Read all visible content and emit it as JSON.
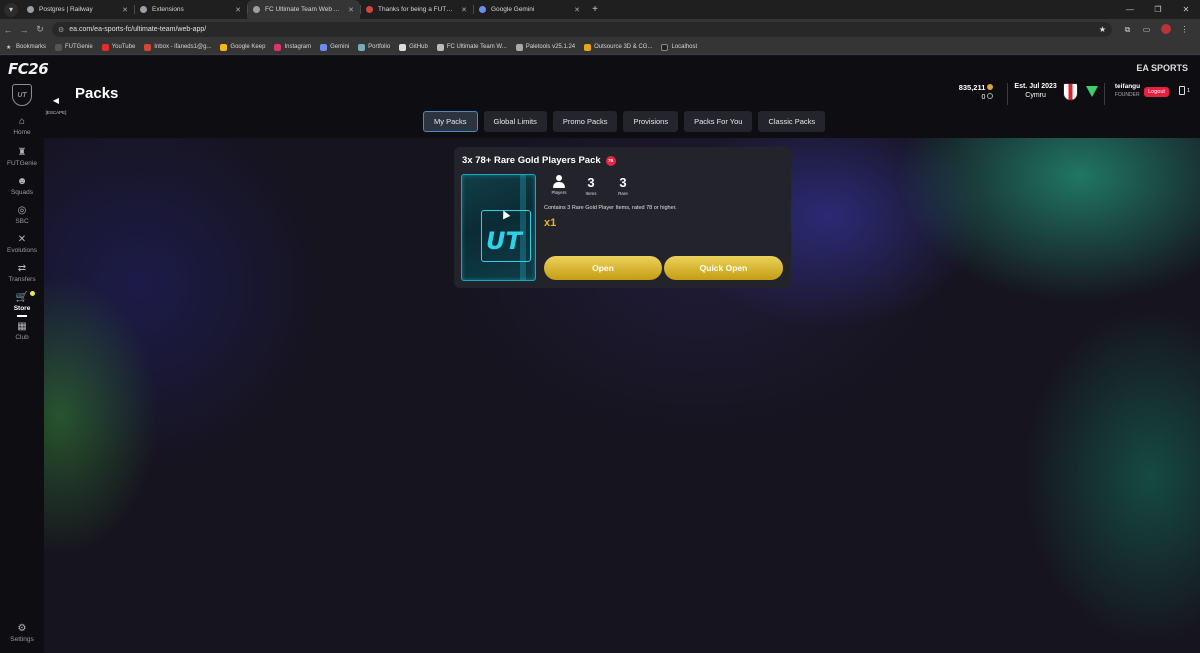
{
  "browser": {
    "tabs": [
      {
        "title": "Postgres | Railway",
        "active": false
      },
      {
        "title": "Extensions",
        "active": false
      },
      {
        "title": "FC Ultimate Team Web App - U",
        "active": true
      },
      {
        "title": "Thanks for being a FUTGenie F",
        "active": false
      },
      {
        "title": "Google Gemini",
        "active": false
      }
    ],
    "url": "ea.com/ea-sports-fc/ultimate-team/web-app/",
    "bookmarks": [
      "Bookmarks",
      "FUTGenie",
      "YouTube",
      "Inbox - ifaneds1@g...",
      "Google Keep",
      "Instagram",
      "Gemini",
      "Portfolio",
      "GitHub",
      "FC Ultimate Team W...",
      "Paletools v25.1.24",
      "Outsource 3D & CG...",
      "Localhost"
    ]
  },
  "app": {
    "logo": "FC26",
    "brand": "EA SPORTS",
    "ut_badge": "UT",
    "back_hint": "[ESCAPE]",
    "page_title": "Packs"
  },
  "nav": [
    {
      "label": "Home",
      "icon": "home-icon"
    },
    {
      "label": "FUTGenie",
      "icon": "genie-icon"
    },
    {
      "label": "Squads",
      "icon": "squads-icon"
    },
    {
      "label": "SBC",
      "icon": "sbc-icon"
    },
    {
      "label": "Evolutions",
      "icon": "evolutions-icon"
    },
    {
      "label": "Transfers",
      "icon": "transfers-icon"
    },
    {
      "label": "Store",
      "icon": "cart-icon",
      "active": true
    },
    {
      "label": "Club",
      "icon": "club-icon"
    },
    {
      "label": "Settings",
      "icon": "gear-icon"
    }
  ],
  "user": {
    "coins": "835,211",
    "points": "0",
    "established": "Est. Jul 2023",
    "club_name": "Cymru",
    "username": "teifangu",
    "role": "FOUNDER",
    "logout": "Logout",
    "devices": "1"
  },
  "pack_tabs": [
    "My Packs",
    "Global Limits",
    "Promo Packs",
    "Provisions",
    "Packs For You",
    "Classic Packs"
  ],
  "pack": {
    "title": "3x 78+ Rare Gold Players Pack",
    "untradeable_tag": "76",
    "pack_art": "UT",
    "stats": [
      {
        "value": "",
        "label": "Players"
      },
      {
        "value": "3",
        "label": "Items"
      },
      {
        "value": "3",
        "label": "Rare"
      }
    ],
    "description": "Contains 3 Rare Gold Player Items, rated 78 or higher.",
    "quantity": "x1",
    "open_label": "Open",
    "quick_open_label": "Quick Open"
  },
  "colors": {
    "accent_gold": "#e3b522",
    "logout_red": "#e5213f",
    "tab_active_border": "#4a8acb",
    "pack_cyan": "#2cd3e8"
  }
}
